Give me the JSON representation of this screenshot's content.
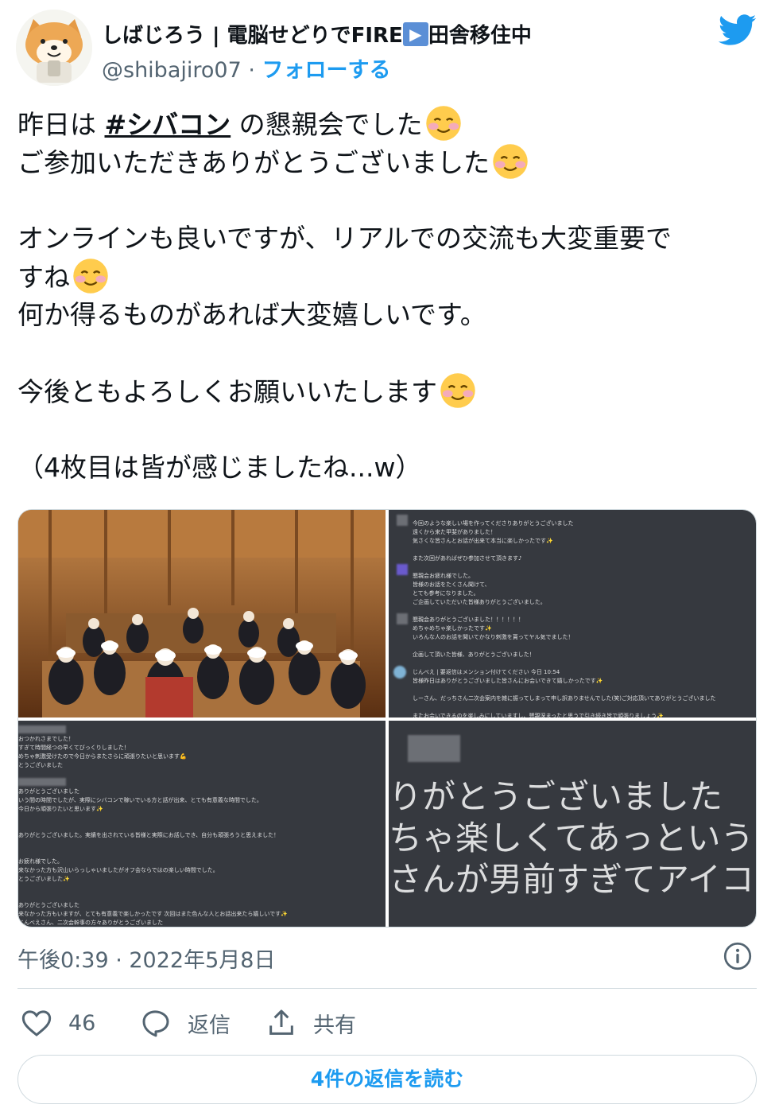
{
  "author": {
    "name_prefix": "しばじろう | 電脳せどりでFIRE",
    "name_badge": "▶",
    "name_suffix": "田舎移住中",
    "handle": "@shibajiro07",
    "separator": "·",
    "follow_label": "フォローする",
    "avatar_icon": "shiba-dog-avatar-icon"
  },
  "brand_icon": "twitter-bird-icon",
  "tweet": {
    "line1_before": "昨日は ",
    "hashtag": "#シバコン",
    "line1_after": " の懇親会でした",
    "line2": "ご参加いただきありがとうございました",
    "line3": "オンラインも良いですが、リアルでの交流も大変重要で",
    "line4": "すね",
    "line5": "何か得るものがあれば大変嬉しいです。",
    "line6": "今後ともよろしくお願いいたします",
    "line7": "（4枚目は皆が感じましたね...w）",
    "emoji_icon": "smiling-face-with-blush-emoji"
  },
  "media": {
    "photo1": "group-photo-restaurant",
    "photo2_lines": [
      "今回のような楽しい場を作ってくださりありがとうございました",
      "遠くから来た甲斐がありました！",
      "気さくな皆さんとお話が出来て本当に楽しかったです✨",
      "",
      "また次回があればぜひ参加させて頂きます♪",
      "",
      "懇親会お疲れ様でした。",
      "皆様のお話をたくさん聞けて、",
      "とても参考になりました。",
      "ご企画していただいた皆様ありがとうございました。",
      "",
      "懇親会ありがとうございました！！！！！！",
      "めちゃめちゃ楽しかったです✨",
      "いろんな人のお話を聞いてかなり刺激を貰ってヤル気でました！",
      "",
      "企画して頂いた皆様、ありがとうございました！",
      "",
      "じんべえ | 要返信はメンション付けてください  今日 10:54",
      "皆様昨日はありがとうございました皆さんにお会いできて嬉しかったです✨",
      "",
      "しーさん、だっちさん二次会案内を雑に振ってしまって申し訳ありませんでした(笑)ご対応頂いてありがとうございました",
      "",
      "またお会いできるのを楽しみにしていますし、懇親深まったと思うで引き続き皆で頑張りましょう✨"
    ],
    "photo3_lines": [
      "おつかれさまでした！",
      "すぎて時間経つの早くてびっくりしました！",
      "めちゃ刺激受けたので今日からまたさらに頑張りたいと思います💪",
      "とうございました",
      "",
      "",
      "ありがとうございました",
      "いう間の時間でしたが、実際にシバコンで稼いでいる方と話が出来、とても有意義な時間でした。",
      "今日から頑張りたいと思います✨",
      "",
      "",
      "ありがとうございました。実績を出されている皆様と実際にお話しでき、自分も頑張ろうと思えました！",
      "",
      "",
      "お疲れ様でした。",
      "来なかった方も沢山いらっしゃいましたがオフ会ならではの楽しい時間でした。",
      "とうございました✨",
      "",
      "",
      "ありがとうございました",
      "来なかった方もいますが、とても有意義で楽しかったです 次回はまた色んな人とお話出来たら嬉しいです✨",
      "じんべえさん、二次会幹事の方々ありがとうございました"
    ],
    "photo4_lines": [
      "りがとうございました",
      "ちゃ楽しくてあっという間の時",
      "さんが男前すぎてアイコン詐欺"
    ]
  },
  "timestamp": "午後0:39 · 2022年5月8日",
  "info_icon": "info-icon",
  "actions": {
    "like_count": "46",
    "reply_label": "返信",
    "share_label": "共有"
  },
  "read_replies_label": "4件の返信を読む",
  "colors": {
    "accent": "#1d9bf0",
    "secondary_text": "#536471",
    "discord_bg": "#36393f",
    "border": "#cfd9de"
  }
}
